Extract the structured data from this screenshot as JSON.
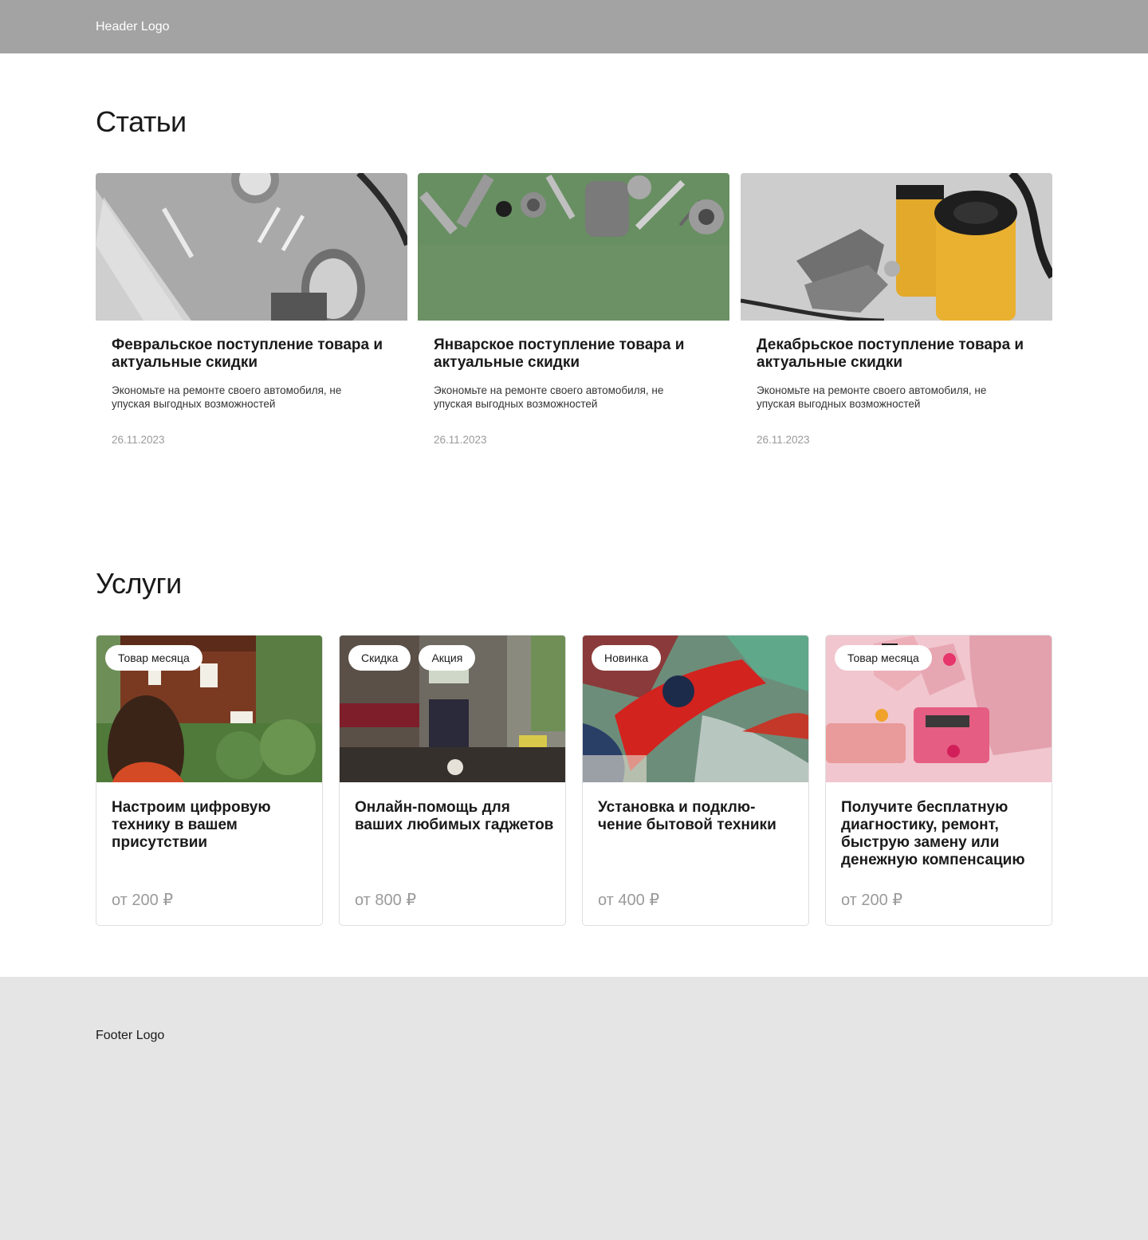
{
  "header": {
    "logo": "Header Logo"
  },
  "articles_section": {
    "title": "Статьи",
    "items": [
      {
        "title": "Февральское поступление товара и актуальные скидки",
        "description": "Экономьте на ремонте своего автомобиля, не упуская выгодных возможностей",
        "date": "26.11.2023"
      },
      {
        "title": "Январское поступление товара и актуальные скидки",
        "description": "Экономьте на ремонте своего автомобиля, не упуская выгодных возможностей",
        "date": "26.11.2023"
      },
      {
        "title": "Декабрьское поступление товара и актуальные скидки",
        "description": "Экономьте на ремонте своего автомобиля, не упуская выгодных возможностей",
        "date": "26.11.2023"
      }
    ]
  },
  "services_section": {
    "title": "Услуги",
    "items": [
      {
        "badges": [
          "Товар месяца"
        ],
        "title": "Настроим цифровую технику в вашем присутствии",
        "price": "от 200 ₽"
      },
      {
        "badges": [
          "Скидка",
          "Акция"
        ],
        "title": "Онлайн-помощь для ваших любимых гаджетов",
        "price": "от 800 ₽"
      },
      {
        "badges": [
          "Новинка"
        ],
        "title": "Установка и подклю-чение бытовой техники",
        "price": "от 400 ₽"
      },
      {
        "badges": [
          "Товар месяца"
        ],
        "title": "Получите бесплатную диагностику, ремонт, быструю замену или денежную компенсацию",
        "price": "от 200 ₽"
      }
    ]
  },
  "footer": {
    "logo": "Footer Logo"
  }
}
